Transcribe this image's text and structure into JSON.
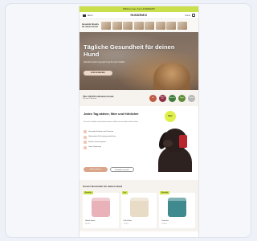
{
  "promo_bar": {
    "text": "Willkommen bei HUNDEMIX"
  },
  "header": {
    "menu_label": "Menü",
    "logo": "HUNDEMIX",
    "account_label": "Konto",
    "cart_label": "Warenkorb"
  },
  "hero_top": {
    "text": "Gesunde Snacks für deinen Hund"
  },
  "hero": {
    "title": "Tägliche Gesundheit für deinen Hund",
    "subtitle": "Natürliche Nahrungsergänzung für mehr Vitalität",
    "cta": "Jetzt entdecken"
  },
  "trust": {
    "main": "Über 100.000 zufriedene Hunde",
    "sub": "4,8 von 5 Sternen",
    "badges": [
      {
        "label": "Bio",
        "color": "#c05b43"
      },
      {
        "label": "Made in EU",
        "color": "#8f2d42"
      },
      {
        "label": "Natürlich",
        "color": "#3f7a3a"
      },
      {
        "label": "Vegan",
        "color": "#5f8c3b"
      },
      {
        "label": "Tierarzt",
        "color": "#b8b8b8"
      }
    ]
  },
  "section2": {
    "title": "Jeden Tag aktiver, fitter und fröhlicher",
    "desc": "Unsere Produkte unterstützen deinen Hund mit wertvollen Nährstoffen.",
    "features": [
      "Gesunde Gelenke und Knochen",
      "Glänzendes Fell und gesunde Haut",
      "Starkes Immunsystem",
      "Gute Verdauung"
    ],
    "primary_button": "Mehr erfahren",
    "secondary_button": "Produkte ansehen",
    "sticker": "Neu!"
  },
  "products": {
    "title": "Unsere Bestseller für deinen Hund",
    "items": [
      {
        "tag": "Bestseller",
        "name": "Gelenk Snack",
        "price": "29,95 €",
        "color": "#e8b2b8"
      },
      {
        "tag": "Neu",
        "name": "Fell & Haut",
        "price": "27,95 €",
        "color": "#e9dcc6"
      },
      {
        "tag": "Bestseller",
        "name": "Darm Kur",
        "price": "31,95 €",
        "color": "#3f8a8e"
      }
    ]
  }
}
